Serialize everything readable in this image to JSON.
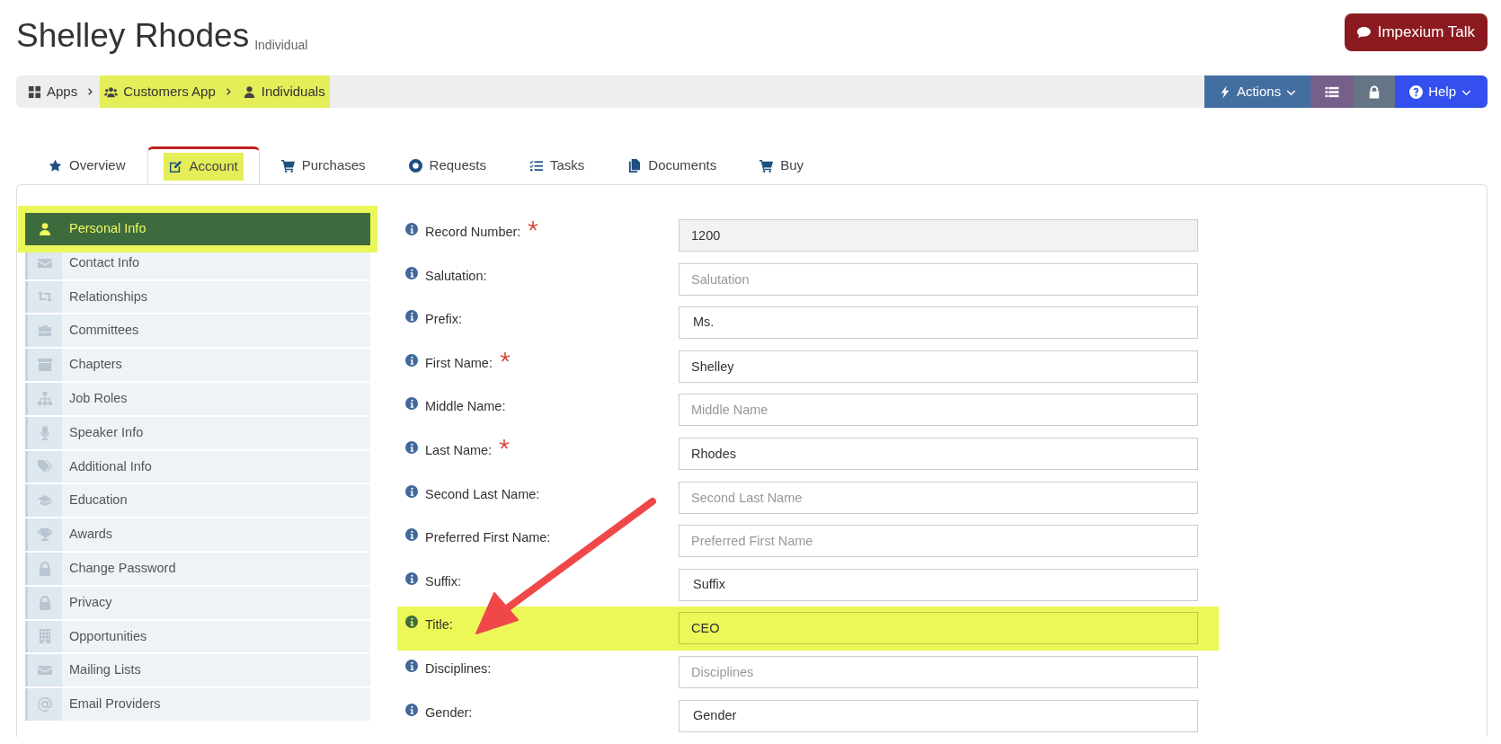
{
  "header": {
    "title": "Shelley Rhodes",
    "subtitle": "Individual",
    "talk_button": "Impexium Talk"
  },
  "breadcrumb": [
    {
      "label": "Apps",
      "highlighted": false
    },
    {
      "label": "Customers App",
      "highlighted": true
    },
    {
      "label": "Individuals",
      "highlighted": true
    }
  ],
  "toolbar": {
    "actions": "Actions",
    "help": "Help"
  },
  "tabs": [
    {
      "label": "Overview",
      "selected": false,
      "highlighted": false
    },
    {
      "label": "Account",
      "selected": true,
      "highlighted": true
    },
    {
      "label": "Purchases",
      "selected": false,
      "highlighted": false
    },
    {
      "label": "Requests",
      "selected": false,
      "highlighted": false
    },
    {
      "label": "Tasks",
      "selected": false,
      "highlighted": false
    },
    {
      "label": "Documents",
      "selected": false,
      "highlighted": false
    },
    {
      "label": "Buy",
      "selected": false,
      "highlighted": false
    }
  ],
  "sidebar": {
    "items": [
      {
        "label": "Personal Info",
        "selected": true,
        "highlighted": true
      },
      {
        "label": "Contact Info",
        "selected": false,
        "highlighted": false
      },
      {
        "label": "Relationships",
        "selected": false,
        "highlighted": false
      },
      {
        "label": "Committees",
        "selected": false,
        "highlighted": false
      },
      {
        "label": "Chapters",
        "selected": false,
        "highlighted": false
      },
      {
        "label": "Job Roles",
        "selected": false,
        "highlighted": false
      },
      {
        "label": "Speaker Info",
        "selected": false,
        "highlighted": false
      },
      {
        "label": "Additional Info",
        "selected": false,
        "highlighted": false
      },
      {
        "label": "Education",
        "selected": false,
        "highlighted": false
      },
      {
        "label": "Awards",
        "selected": false,
        "highlighted": false
      },
      {
        "label": "Change Password",
        "selected": false,
        "highlighted": false
      },
      {
        "label": "Privacy",
        "selected": false,
        "highlighted": false
      },
      {
        "label": "Opportunities",
        "selected": false,
        "highlighted": false
      },
      {
        "label": "Mailing Lists",
        "selected": false,
        "highlighted": false
      },
      {
        "label": "Email Providers",
        "selected": false,
        "highlighted": false
      }
    ]
  },
  "form": {
    "fields": [
      {
        "label": "Record Number:",
        "kind": "readonly",
        "required": true,
        "value": "1200",
        "highlighted": false
      },
      {
        "label": "Salutation:",
        "kind": "text",
        "required": false,
        "placeholder": "Salutation",
        "highlighted": false
      },
      {
        "label": "Prefix:",
        "kind": "select",
        "required": false,
        "value": "Ms.",
        "highlighted": false
      },
      {
        "label": "First Name:",
        "kind": "text",
        "required": true,
        "value": "Shelley",
        "highlighted": false
      },
      {
        "label": "Middle Name:",
        "kind": "text",
        "required": false,
        "placeholder": "Middle Name",
        "highlighted": false
      },
      {
        "label": "Last Name:",
        "kind": "text",
        "required": true,
        "value": "Rhodes",
        "highlighted": false
      },
      {
        "label": "Second Last Name:",
        "kind": "text",
        "required": false,
        "placeholder": "Second Last Name",
        "highlighted": false
      },
      {
        "label": "Preferred First Name:",
        "kind": "text",
        "required": false,
        "placeholder": "Preferred First Name",
        "highlighted": false
      },
      {
        "label": "Suffix:",
        "kind": "select",
        "required": false,
        "value": "Suffix",
        "highlighted": false
      },
      {
        "label": "Title:",
        "kind": "text",
        "required": false,
        "value": "CEO",
        "highlighted": true
      },
      {
        "label": "Disciplines:",
        "kind": "text",
        "required": false,
        "placeholder": "Disciplines",
        "highlighted": false
      },
      {
        "label": "Gender:",
        "kind": "select",
        "required": false,
        "value": "Gender",
        "highlighted": false
      }
    ]
  }
}
